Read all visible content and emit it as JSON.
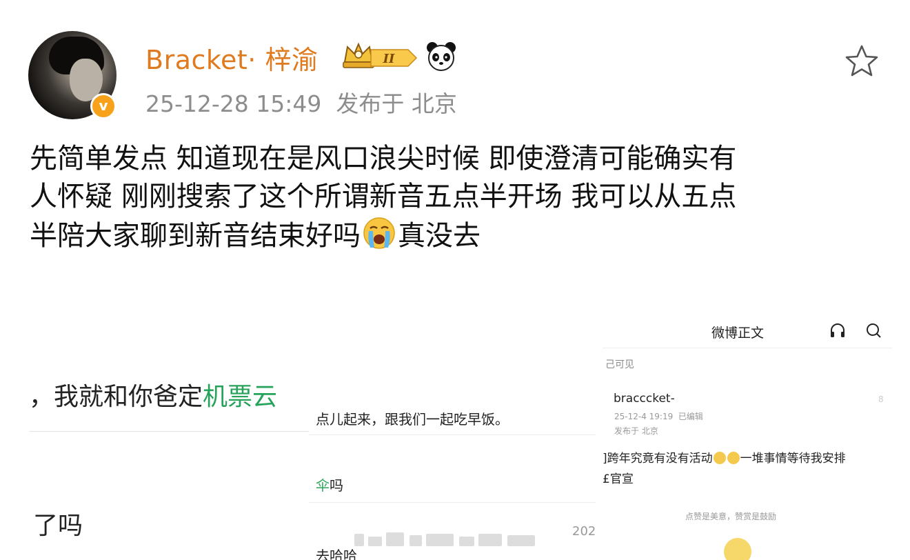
{
  "post": {
    "username": "Bracket· 梓渝",
    "timestamp": "25-12-28 15:49",
    "location": "发布于 北京",
    "badge_level": "II",
    "icons": [
      "verified-v-icon",
      "crown-level-icon",
      "panda-icon",
      "favorite-star-icon"
    ],
    "verified_mark": "v",
    "body_lines": [
      "先简单发点 知道现在是风口浪尖时候 即使澄清可能确实有",
      "人怀疑 刚刚搜索了这个所谓新音五点半开场 我可以从五点",
      "半陪大家聊到新音结束好吗"
    ],
    "body_tail": "真没去",
    "body_emoji": "crying-face-emoji"
  },
  "image1": {
    "line1_prefix": "，我就和你爸定",
    "line1_green": "机票",
    "line1_cut": "云",
    "line2": "了吗"
  },
  "image2": {
    "line1": "点儿起来，跟我们一起吃早饭。",
    "line2_green": "伞",
    "line2": "吗",
    "line3": "去哈哈",
    "year_fragment": "202"
  },
  "image3": {
    "title": "微博正文",
    "visibility_fragment": "己可见",
    "name": "bracccket-",
    "date": "25-12-4 19:19",
    "edited": "已编辑",
    "place": "发布于 北京",
    "body_line1_prefix": "]跨年究竟有没有活动",
    "body_line1_suffix": "一堆事情等待我安排",
    "body_line2": "£官宣",
    "reward_tip": "点赞是美意，赞赏是鼓励",
    "side_fragment": "8"
  },
  "colors": {
    "username": "#e07a1f",
    "meta": "#8d8d8d",
    "green": "#26a35a",
    "badge": "#f7a21a"
  }
}
